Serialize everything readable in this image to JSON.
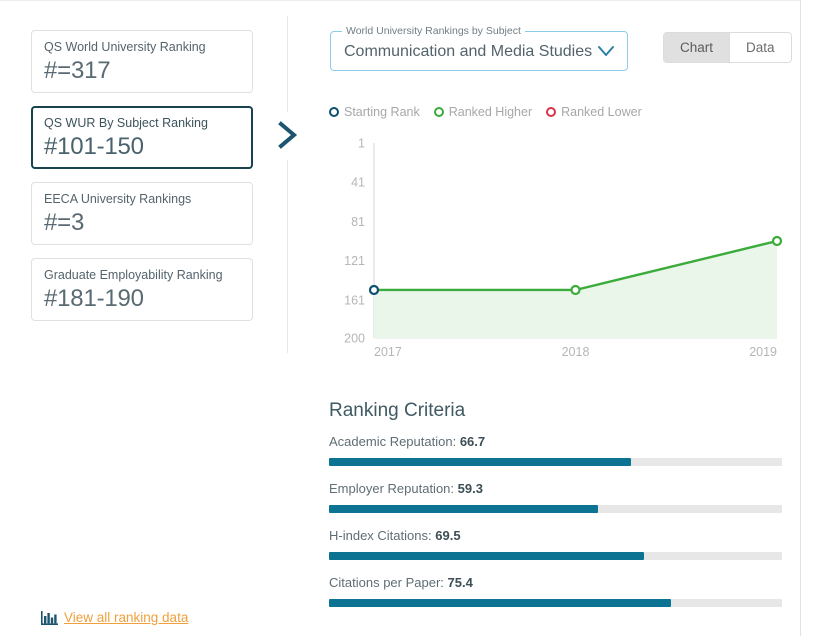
{
  "rank_cards": [
    {
      "title": "QS World University Ranking",
      "value": "#=317",
      "selected": false
    },
    {
      "title": "QS WUR By Subject Ranking",
      "value": "#101-150",
      "selected": true
    },
    {
      "title": "EECA University Rankings",
      "value": "#=3",
      "selected": false
    },
    {
      "title": "Graduate Employability Ranking",
      "value": "#181-190",
      "selected": false
    }
  ],
  "subject_select": {
    "label": "World University Rankings by Subject",
    "value": "Communication and Media Studies",
    "caret_icon": "chevron-down-icon"
  },
  "view_toggle": {
    "chart_label": "Chart",
    "data_label": "Data",
    "active": "Chart"
  },
  "legend": [
    {
      "label": "Starting Rank",
      "color": "#0c4f6e"
    },
    {
      "label": "Ranked Higher",
      "color": "#3bab3b"
    },
    {
      "label": "Ranked Lower",
      "color": "#d9334a"
    }
  ],
  "chart_data": {
    "type": "line",
    "title": "",
    "xlabel": "",
    "ylabel": "",
    "x": [
      "2017",
      "2018",
      "2019"
    ],
    "categories": [
      "2017",
      "2018",
      "2019"
    ],
    "values": [
      151,
      151,
      101
    ],
    "series": [
      {
        "name": "QS WUR By Subject Ranking",
        "values": [
          151,
          151,
          101
        ]
      }
    ],
    "point_colors": [
      "#0c4f6e",
      "#3bab3b",
      "#3bab3b"
    ],
    "line_color": "#3bab3b",
    "area_fill": "#eaf6ea",
    "ylim": [
      1,
      200
    ],
    "y_inverted": true,
    "yticks": [
      1,
      41,
      81,
      121,
      161,
      200
    ],
    "ytick_labels": [
      "1",
      "41",
      "81",
      "121",
      "161",
      "200"
    ],
    "xtick_labels": [
      "2017",
      "2018",
      "2019"
    ],
    "grid": false,
    "legend_position": "top-left"
  },
  "criteria": {
    "title": "Ranking Criteria",
    "items": [
      {
        "name": "Academic Reputation",
        "value": "66.7",
        "percent": 66.7
      },
      {
        "name": "Employer Reputation",
        "value": "59.3",
        "percent": 59.3
      },
      {
        "name": "H-index Citations",
        "value": "69.5",
        "percent": 69.5
      },
      {
        "name": "Citations per Paper",
        "value": "75.4",
        "percent": 75.4
      }
    ],
    "bar_color": "#0d7392",
    "track_color": "#e7e7e7"
  },
  "footer": {
    "link_label": "View all ranking data",
    "link_icon": "bar-chart-icon",
    "link_color": "#f0a03c"
  }
}
